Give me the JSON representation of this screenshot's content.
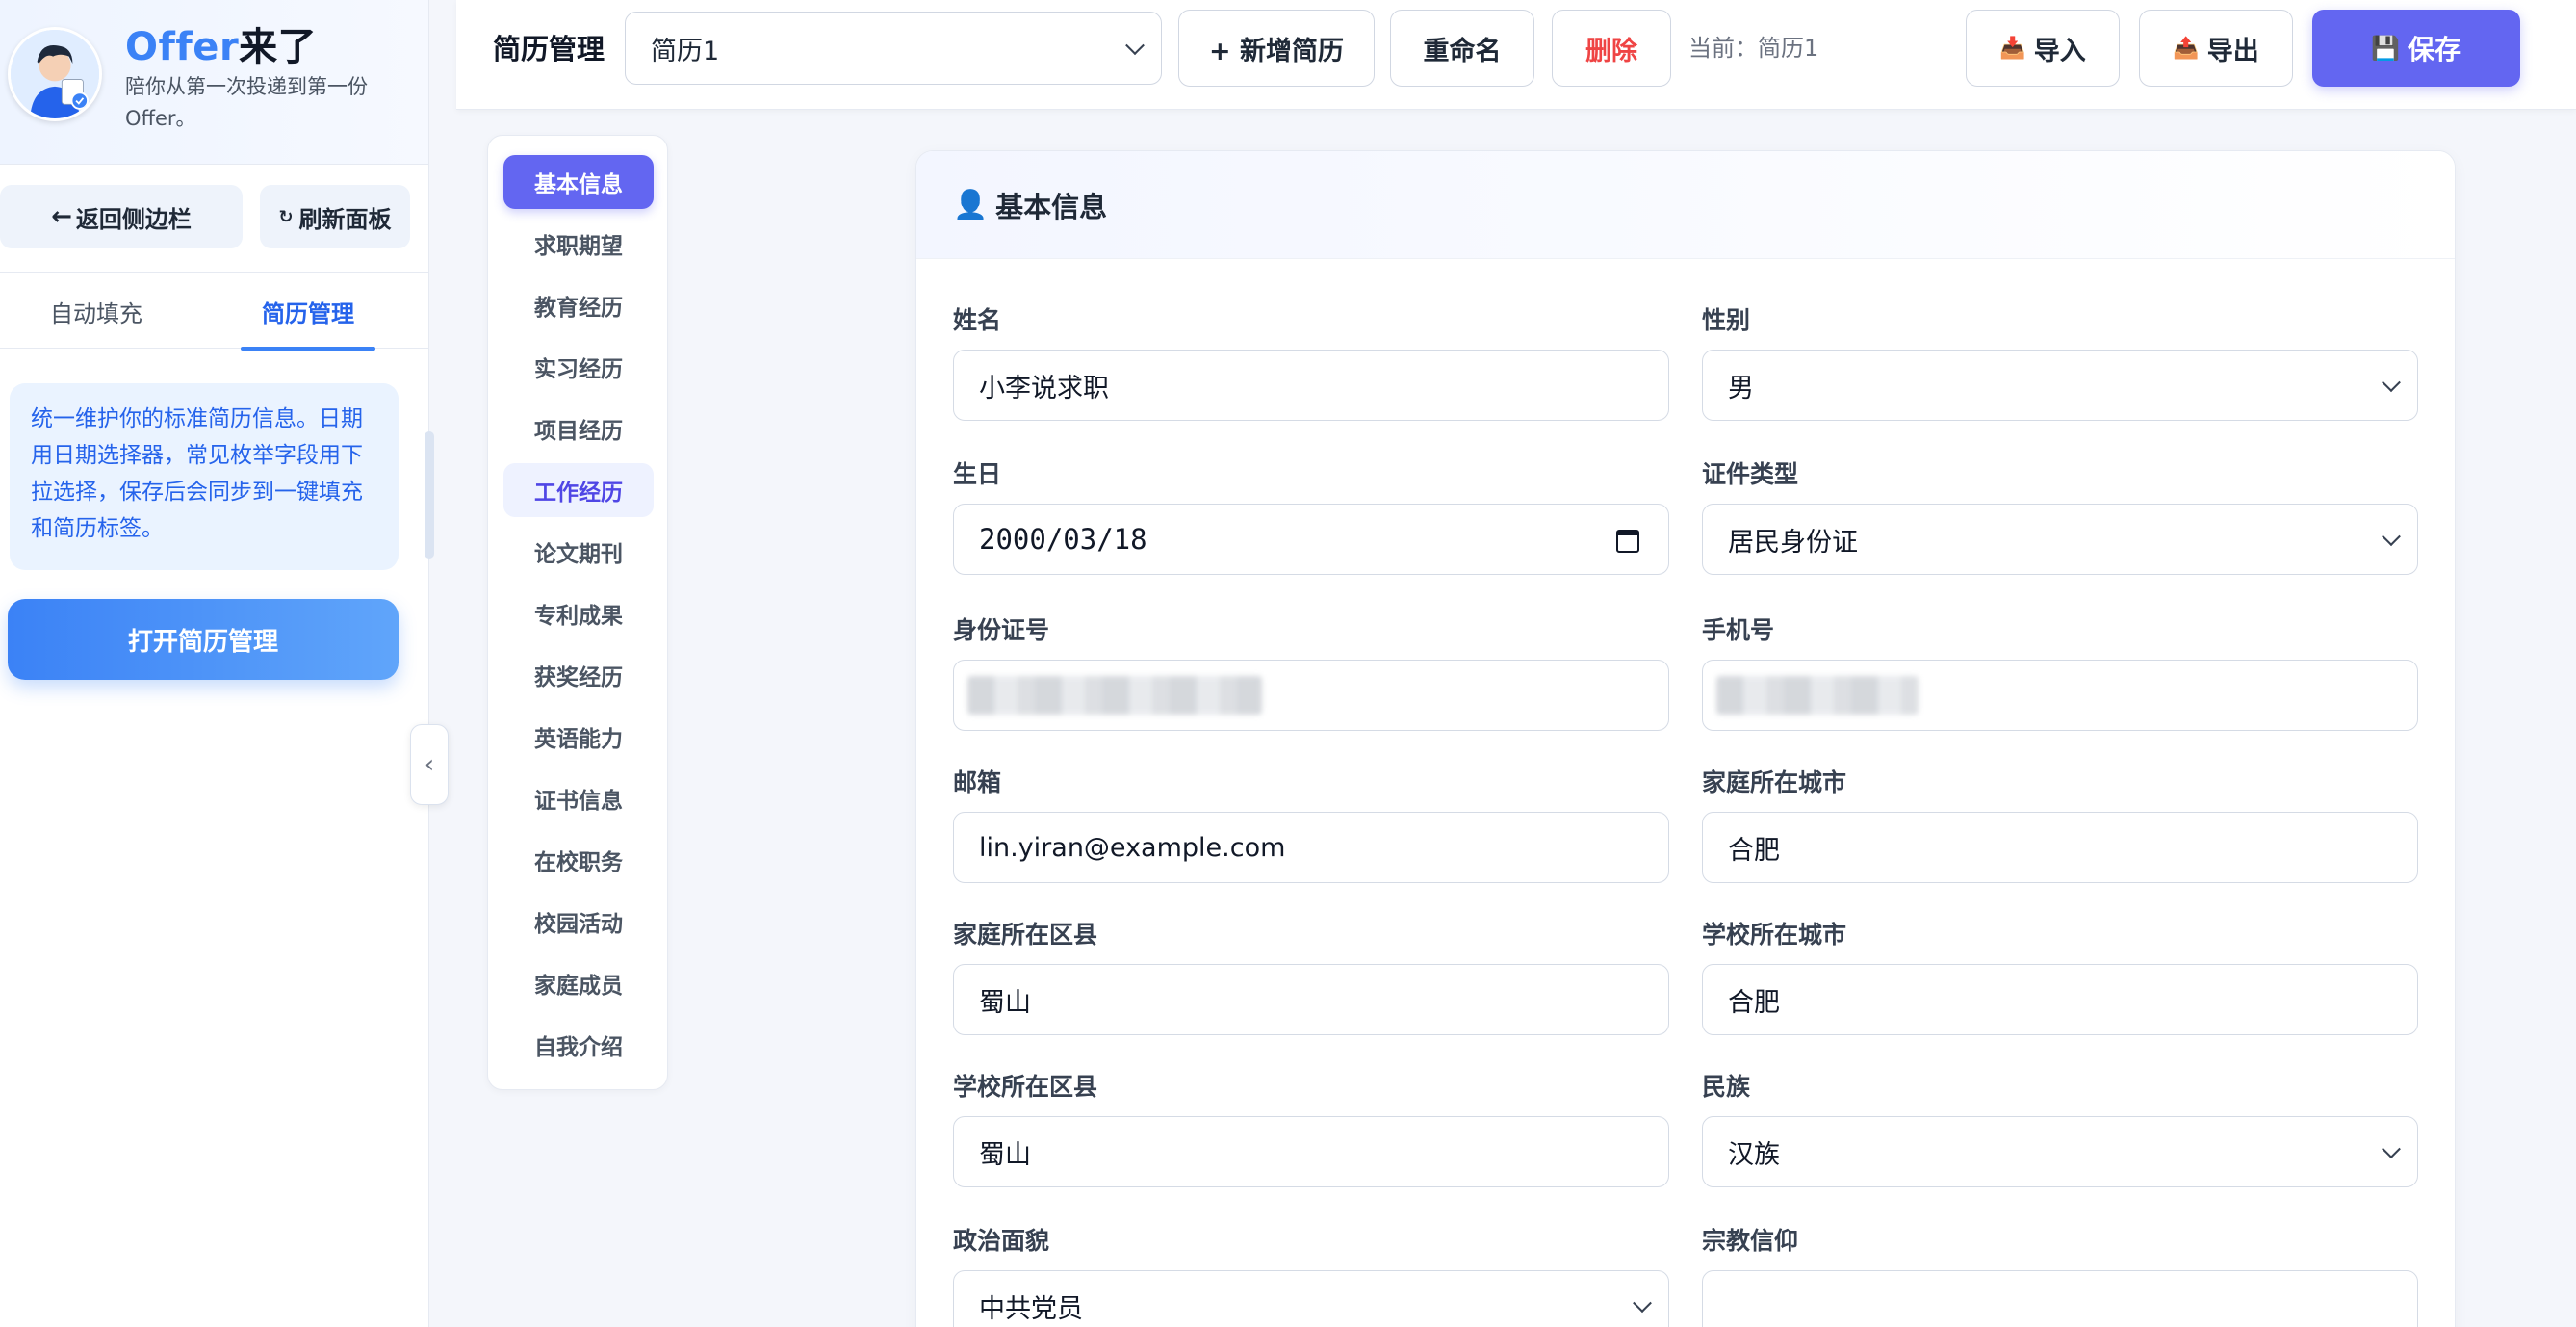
{
  "brand": {
    "title_prefix": "Offer",
    "title_suffix": "来了",
    "subtitle": "陪你从第一次投递到第一份 Offer。"
  },
  "panel": {
    "back_label": "返回侧边栏",
    "back_icon": "arrow-left-icon",
    "refresh_label": "刷新面板",
    "refresh_icon": "refresh-icon",
    "tabs": [
      "自动填充",
      "简历管理"
    ],
    "active_tab": "简历管理",
    "info_text": "统一维护你的标准简历信息。日期用日期选择器，常见枚举字段用下拉选择，保存后会同步到一键填充和简历标签。",
    "open_button": "打开简历管理",
    "collapse_glyph": "‹"
  },
  "toolbar": {
    "title": "简历管理",
    "selected_resume": "简历1",
    "new_label": "+ 新增简历",
    "rename_label": "重命名",
    "delete_label": "删除",
    "current_text": "当前：简历1",
    "import_label": "导入",
    "export_label": "导出",
    "save_label": "保存",
    "import_icon": "inbox-tray-icon",
    "export_icon": "outbox-tray-icon",
    "save_icon": "floppy-disk-icon"
  },
  "sections": [
    "基本信息",
    "求职期望",
    "教育经历",
    "实习经历",
    "项目经历",
    "工作经历",
    "论文期刊",
    "专利成果",
    "获奖经历",
    "英语能力",
    "证书信息",
    "在校职务",
    "校园活动",
    "家庭成员",
    "自我介绍"
  ],
  "active_section": "基本信息",
  "form": {
    "heading": "基本信息",
    "heading_icon": "person-icon",
    "fields": {
      "name": {
        "label": "姓名",
        "value": "小李说求职"
      },
      "gender": {
        "label": "性别",
        "value": "男"
      },
      "birthday": {
        "label": "生日",
        "value": "2000/03/18"
      },
      "id_type": {
        "label": "证件类型",
        "value": "居民身份证"
      },
      "id_number": {
        "label": "身份证号",
        "value": ""
      },
      "phone": {
        "label": "手机号",
        "value": ""
      },
      "email": {
        "label": "邮箱",
        "value": "lin.yiran@example.com"
      },
      "home_city": {
        "label": "家庭所在城市",
        "value": "合肥"
      },
      "home_district": {
        "label": "家庭所在区县",
        "value": "蜀山"
      },
      "school_city": {
        "label": "学校所在城市",
        "value": "合肥"
      },
      "school_district": {
        "label": "学校所在区县",
        "value": "蜀山"
      },
      "ethnicity": {
        "label": "民族",
        "value": "汉族"
      },
      "political": {
        "label": "政治面貌",
        "value": "中共党员"
      },
      "religion": {
        "label": "宗教信仰",
        "value": ""
      }
    }
  },
  "colors": {
    "accent": "#6366f1",
    "primary_blue": "#3b82f6",
    "danger": "#ef4444"
  }
}
